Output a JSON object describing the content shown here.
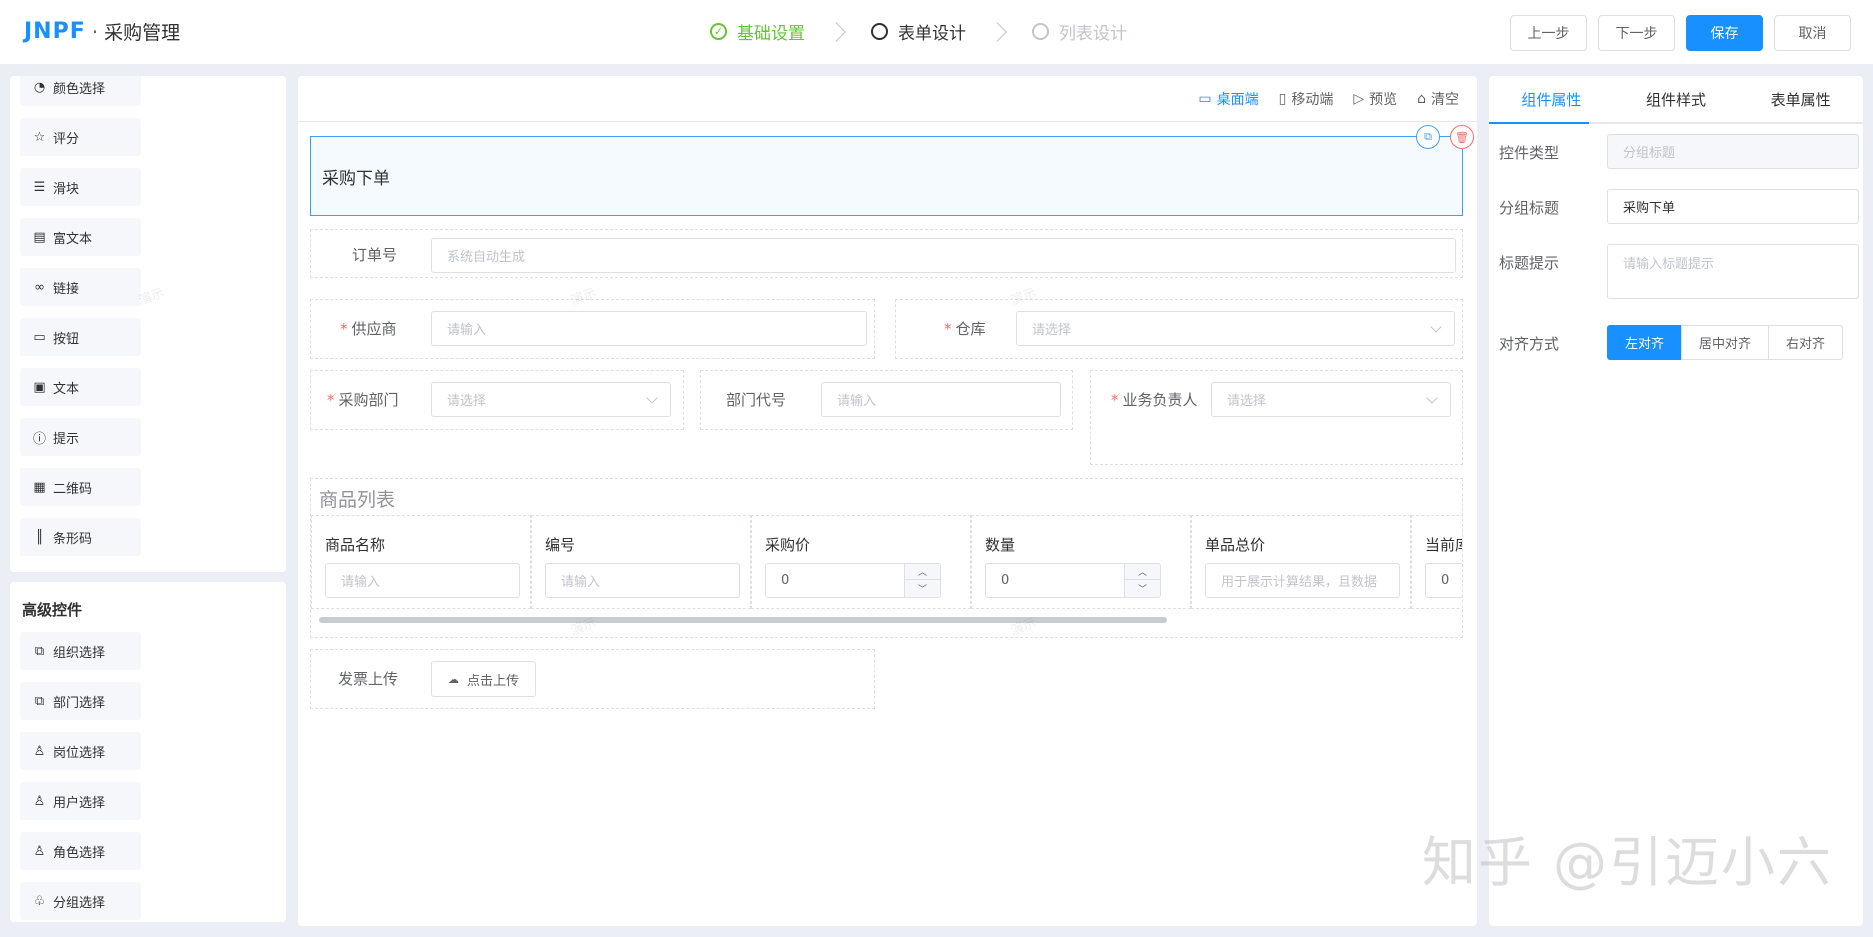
{
  "header": {
    "logo_text": "JNPF",
    "separator": "·",
    "app_title": "采购管理",
    "steps": [
      {
        "label": "基础设置",
        "state": "done"
      },
      {
        "label": "表单设计",
        "state": "active"
      },
      {
        "label": "列表设计",
        "state": "pending"
      }
    ],
    "buttons": {
      "prev": "上一步",
      "next": "下一步",
      "save": "保存",
      "cancel": "取消"
    }
  },
  "left_panel": {
    "basic_items": [
      {
        "label": "颜色选择",
        "icon": "palette-icon"
      },
      {
        "label": "评分",
        "icon": "star-icon"
      },
      {
        "label": "滑块",
        "icon": "slider-icon"
      },
      {
        "label": "富文本",
        "icon": "rich-text-icon"
      },
      {
        "label": "链接",
        "icon": "link-icon"
      },
      {
        "label": "按钮",
        "icon": "button-icon"
      },
      {
        "label": "文本",
        "icon": "text-icon"
      },
      {
        "label": "提示",
        "icon": "alert-icon"
      },
      {
        "label": "二维码",
        "icon": "qrcode-icon"
      },
      {
        "label": "条形码",
        "icon": "barcode-icon"
      }
    ],
    "advanced_title": "高级控件",
    "advanced_items": [
      {
        "label": "组织选择",
        "icon": "org-icon"
      },
      {
        "label": "部门选择",
        "icon": "dept-icon"
      },
      {
        "label": "岗位选择",
        "icon": "position-icon"
      },
      {
        "label": "用户选择",
        "icon": "user-icon"
      },
      {
        "label": "角色选择",
        "icon": "role-icon"
      },
      {
        "label": "分组选择",
        "icon": "group-icon"
      }
    ]
  },
  "canvas": {
    "toolbar": {
      "desktop": "桌面端",
      "mobile": "移动端",
      "preview": "预览",
      "clear": "清空"
    },
    "group_title": "采购下单",
    "fields": {
      "order_no": {
        "label": "订单号",
        "placeholder": "系统自动生成"
      },
      "supplier": {
        "label": "供应商",
        "placeholder": "请输入",
        "required": "*"
      },
      "warehouse": {
        "label": "仓库",
        "placeholder": "请选择",
        "required": "*"
      },
      "purchase_dept": {
        "label": "采购部门",
        "placeholder": "请选择",
        "required": "*"
      },
      "dept_code": {
        "label": "部门代号",
        "placeholder": "请输入"
      },
      "owner": {
        "label": "业务负责人",
        "placeholder": "请选择",
        "required": "*"
      }
    },
    "goods_table": {
      "title": "商品列表",
      "columns": [
        {
          "header": "商品名称",
          "value": "请输入",
          "kind": "text"
        },
        {
          "header": "编号",
          "value": "请输入",
          "kind": "text"
        },
        {
          "header": "采购价",
          "value": "0",
          "kind": "number"
        },
        {
          "header": "数量",
          "value": "0",
          "kind": "number"
        },
        {
          "header": "单品总价",
          "value": "用于展示计算结果，且数据",
          "kind": "text"
        },
        {
          "header": "当前库",
          "value": "0",
          "kind": "number"
        }
      ]
    },
    "upload": {
      "label": "发票上传",
      "button": "点击上传"
    }
  },
  "right_panel": {
    "tabs": [
      "组件属性",
      "组件样式",
      "表单属性"
    ],
    "control_type_label": "控件类型",
    "control_type_value": "分组标题",
    "group_title_label": "分组标题",
    "group_title_value": "采购下单",
    "title_hint_label": "标题提示",
    "title_hint_placeholder": "请输入标题提示",
    "align_label": "对齐方式",
    "align_options": [
      "左对齐",
      "居中对齐",
      "右对齐"
    ]
  },
  "watermark": "知乎 @引迈小六",
  "demo_watermark": "演示"
}
